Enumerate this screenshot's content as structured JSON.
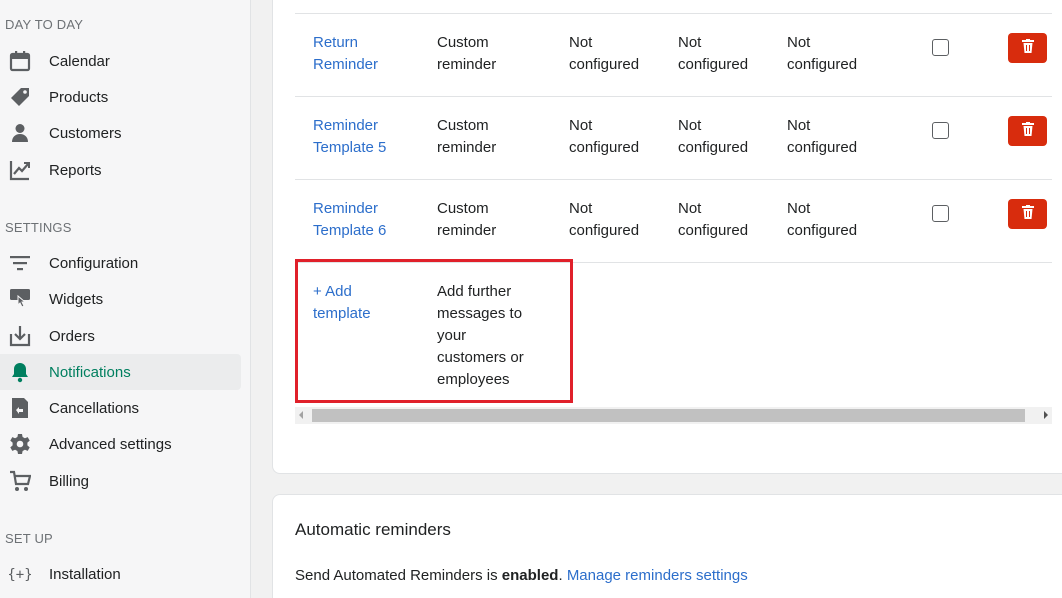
{
  "sidebar": {
    "sections": {
      "day_to_day": "DAY TO DAY",
      "settings": "SETTINGS",
      "set_up": "SET UP"
    },
    "items": [
      {
        "label": "Calendar",
        "icon": "calendar-icon"
      },
      {
        "label": "Products",
        "icon": "tag-icon"
      },
      {
        "label": "Customers",
        "icon": "person-icon"
      },
      {
        "label": "Reports",
        "icon": "chart-icon"
      },
      {
        "label": "Configuration",
        "icon": "filter-icon"
      },
      {
        "label": "Widgets",
        "icon": "widget-icon"
      },
      {
        "label": "Orders",
        "icon": "download-icon"
      },
      {
        "label": "Notifications",
        "icon": "bell-icon",
        "active": true
      },
      {
        "label": "Cancellations",
        "icon": "return-icon"
      },
      {
        "label": "Advanced settings",
        "icon": "gear-icon"
      },
      {
        "label": "Billing",
        "icon": "cart-icon"
      },
      {
        "label": "Installation",
        "icon": "code-icon"
      }
    ]
  },
  "templates": {
    "rows": [
      {
        "name_line1": "Return",
        "name_line2": "Reminder",
        "type_line1": "Custom",
        "type_line2": "reminder",
        "c1_line1": "Not",
        "c1_line2": "configured",
        "c2_line1": "Not",
        "c2_line2": "configured",
        "c3_line1": "Not",
        "c3_line2": "configured"
      },
      {
        "name_line1": "Reminder",
        "name_line2": "Template 5",
        "type_line1": "Custom",
        "type_line2": "reminder",
        "c1_line1": "Not",
        "c1_line2": "configured",
        "c2_line1": "Not",
        "c2_line2": "configured",
        "c3_line1": "Not",
        "c3_line2": "configured"
      },
      {
        "name_line1": "Reminder",
        "name_line2": "Template 6",
        "type_line1": "Custom",
        "type_line2": "reminder",
        "c1_line1": "Not",
        "c1_line2": "configured",
        "c2_line1": "Not",
        "c2_line2": "configured",
        "c3_line1": "Not",
        "c3_line2": "configured"
      }
    ],
    "add": {
      "link_line1": "+ Add",
      "link_line2": "template",
      "desc": [
        "Add further",
        "messages to",
        "your",
        "customers or",
        "employees"
      ]
    }
  },
  "automatic": {
    "title": "Automatic reminders",
    "text_prefix": "Send Automated Reminders is ",
    "text_status": "enabled",
    "text_suffix": ".",
    "link": "Manage reminders settings"
  },
  "colors": {
    "accent_green": "#007f5f",
    "link_blue": "#2c6ecb",
    "delete_red": "#d82c0d",
    "highlight_red": "#e0202a"
  }
}
